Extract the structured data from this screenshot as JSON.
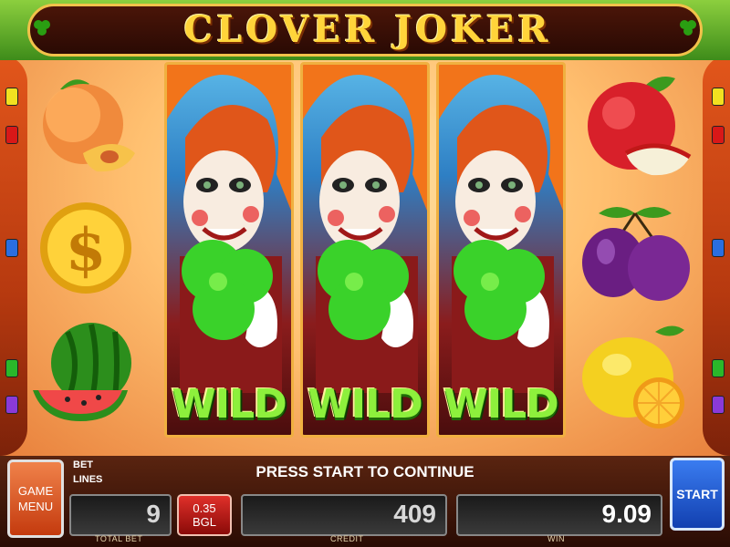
{
  "title": "CLOVER JOKER",
  "reels": {
    "wild_label": "WILD"
  },
  "panel": {
    "menu_line1": "GAME",
    "menu_line2": "MENU",
    "bet_label": "BET",
    "lines_label": "LINES",
    "message": "PRESS START TO CONTINUE",
    "total_bet": "9",
    "total_bet_caption": "TOTAL BET",
    "denomination_value": "0.35",
    "denomination_currency": "BGL",
    "credit": "409",
    "credit_caption": "CREDIT",
    "win": "9.09",
    "win_caption": "WIN",
    "start_label": "START"
  },
  "side_symbols_left": [
    "peach-icon",
    "dollar-coin-icon",
    "watermelon-icon"
  ],
  "side_symbols_right": [
    "apple-icon",
    "plum-icon",
    "lemon-icon"
  ],
  "colors": {
    "title_gold": "#ffd43a",
    "wild_green": "#8df03c",
    "start_blue": "#2a5ee0",
    "menu_orange": "#e0602a"
  }
}
